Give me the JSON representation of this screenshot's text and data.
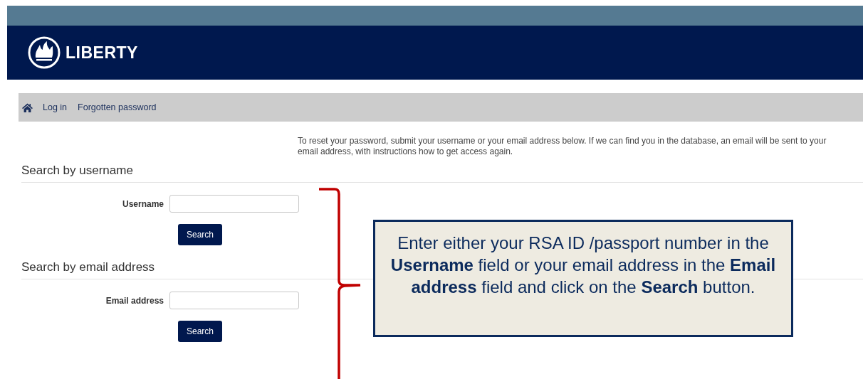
{
  "header": {
    "logo_text": "LIBERTY"
  },
  "breadcrumb": [
    {
      "label": "Log in"
    },
    {
      "label": "Forgotten password"
    }
  ],
  "intro": "To reset your password, submit your username or your email address below. If we can find you in the database, an email will be sent to your email address, with instructions how to get access again.",
  "sections": [
    {
      "heading": "Search by username",
      "field_label": "Username",
      "button": "Search"
    },
    {
      "heading": "Search by email address",
      "field_label": "Email address",
      "button": "Search"
    }
  ],
  "callout": {
    "text": "Enter either your RSA ID /passport number in the **Username** field or your email address in the **Email address** field and click on the **Search** button."
  }
}
